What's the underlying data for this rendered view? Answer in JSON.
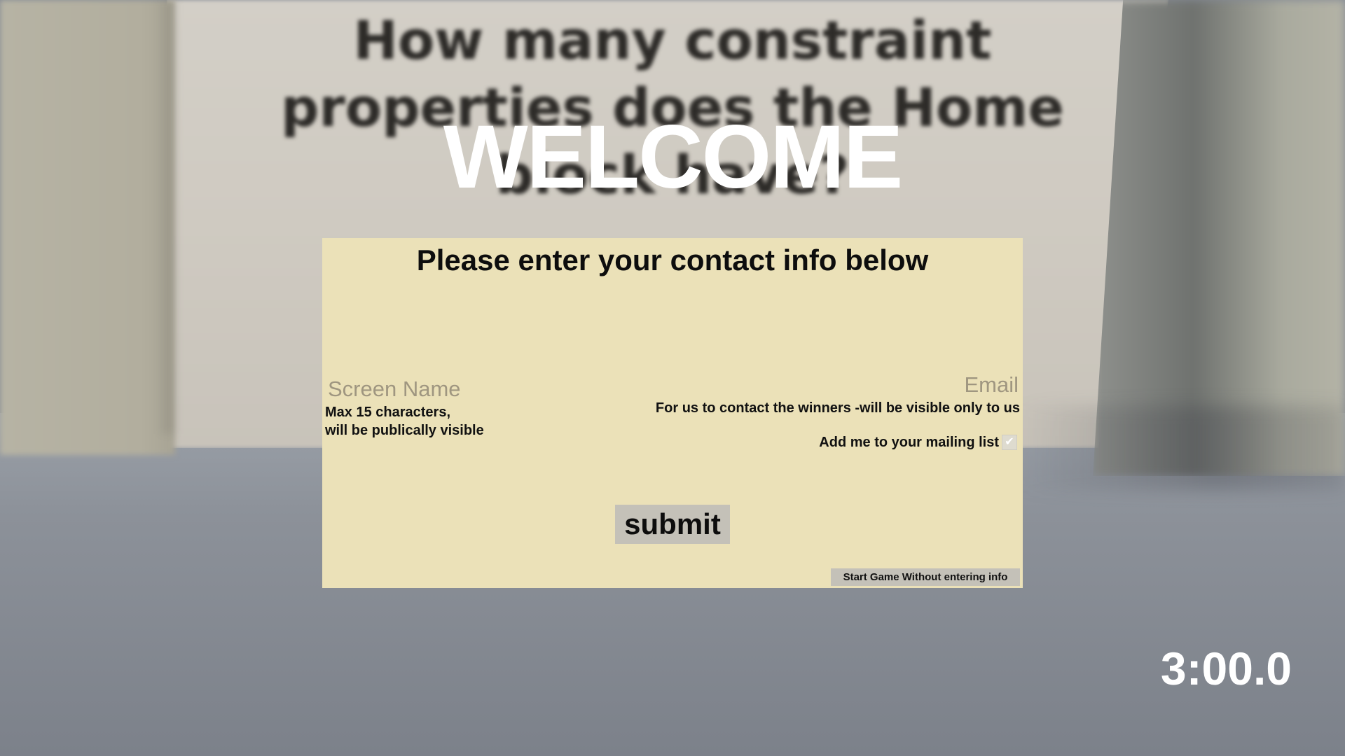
{
  "scene": {
    "wall_question": "How many constraint properties does the Home block have?"
  },
  "welcome": {
    "title": "WELCOME"
  },
  "contact_form": {
    "title": "Please enter your contact info below",
    "screen_name": {
      "placeholder": "Screen Name",
      "value": "",
      "hint_line1": "Max 15 characters,",
      "hint_line2": "will be publically visible"
    },
    "email": {
      "placeholder": "Email",
      "value": "",
      "hint": "For us to contact the winners -will be visible only to us"
    },
    "mailing_list": {
      "label": "Add me to your mailing list",
      "checked": true
    },
    "submit_label": "submit",
    "skip_label": "Start Game Without entering info"
  },
  "hud": {
    "timer": "3:00.0"
  },
  "colors": {
    "panel_background": "#ebe1b8",
    "button_background": "#c4c1b8",
    "placeholder_text": "#9f9680",
    "welcome_text": "#ffffff"
  }
}
